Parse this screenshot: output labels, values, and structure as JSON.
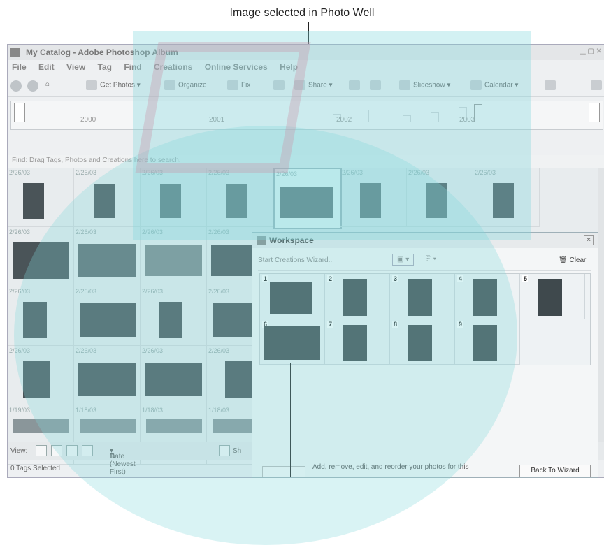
{
  "callouts": {
    "top": "Image selected in Photo Well"
  },
  "app": {
    "title": "My Catalog - Adobe Photoshop Album",
    "menu": [
      "File",
      "Edit",
      "View",
      "Tag",
      "Find",
      "Creations",
      "Online Services",
      "Help"
    ],
    "toolbar": {
      "get_photos": "Get Photos",
      "organize": "Organize",
      "fix": "Fix",
      "share": "Share",
      "slideshow": "Slideshow",
      "calendar": "Calendar"
    },
    "timeline": {
      "years": [
        "2000",
        "2001",
        "2002",
        "2003"
      ]
    },
    "find_bar": "Find: Drag Tags, Photos and Creations here to search.",
    "photo_well": {
      "rows": [
        [
          "2/26/03",
          "2/26/03",
          "2/26/03",
          "2/26/03",
          "2/26/03",
          "2/26/03",
          "2/26/03",
          "2/26/03"
        ],
        [
          "2/26/03",
          "2/26/03",
          "2/26/03",
          "2/26/03"
        ],
        [
          "2/26/03",
          "2/26/03",
          "2/26/03",
          "2/26/03"
        ],
        [
          "2/26/03",
          "2/26/03",
          "2/26/03",
          "2/26/03"
        ],
        [
          "1/19/03",
          "1/18/03",
          "1/18/03",
          "1/18/03"
        ]
      ]
    },
    "view_bar": {
      "label": "View:",
      "sort": "Date (Newest First)",
      "checkbox_label": "Sh"
    },
    "status": "0 Tags Selected"
  },
  "workspace": {
    "title": "Workspace",
    "start_wizard": "Start Creations Wizard...",
    "clear": "Clear",
    "items": [
      "1",
      "2",
      "3",
      "4",
      "5",
      "6",
      "7",
      "8",
      "9"
    ],
    "footer_text": "Add, remove, edit, and reorder your photos for this",
    "back_to_wizard": "Back To Wizard"
  }
}
